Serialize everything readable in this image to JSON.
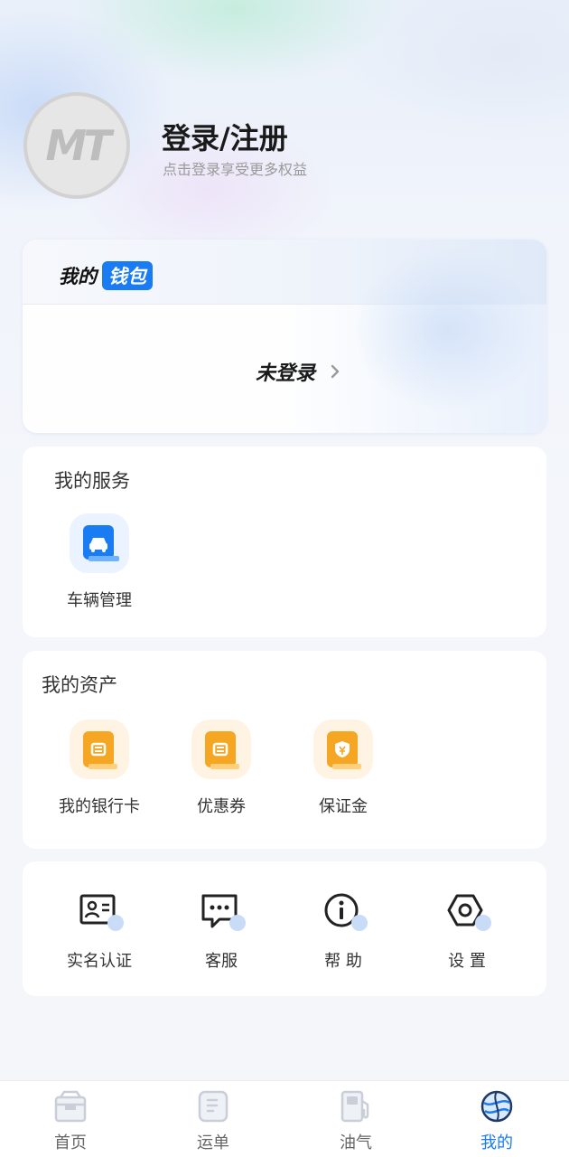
{
  "profile": {
    "avatar_text": "MT",
    "login_title": "登录/注册",
    "login_subtitle": "点击登录享受更多权益"
  },
  "wallet": {
    "label_a": "我的",
    "label_b": "钱包",
    "status": "未登录"
  },
  "services": {
    "title": "我的服务",
    "items": [
      {
        "label": "车辆管理",
        "icon": "car-icon"
      }
    ]
  },
  "assets": {
    "title": "我的资产",
    "items": [
      {
        "label": "我的银行卡",
        "icon": "bank-card-icon"
      },
      {
        "label": "优惠券",
        "icon": "coupon-icon"
      },
      {
        "label": "保证金",
        "icon": "deposit-shield-icon"
      }
    ]
  },
  "tools": {
    "items": [
      {
        "label": "实名认证",
        "icon": "id-card-icon"
      },
      {
        "label": "客服",
        "icon": "chat-icon"
      },
      {
        "label": "帮 助",
        "icon": "info-icon"
      },
      {
        "label": "设 置",
        "icon": "settings-hex-icon"
      }
    ]
  },
  "tabbar": {
    "items": [
      {
        "label": "首页",
        "icon": "home-box-icon",
        "active": false
      },
      {
        "label": "运单",
        "icon": "waybill-icon",
        "active": false
      },
      {
        "label": "油气",
        "icon": "fuel-pump-icon",
        "active": false
      },
      {
        "label": "我的",
        "icon": "profile-globe-icon",
        "active": true
      }
    ]
  },
  "colors": {
    "accent": "#1a7cf2",
    "asset_orange": "#f5a623",
    "dot_blue": "#c9dcf7"
  }
}
